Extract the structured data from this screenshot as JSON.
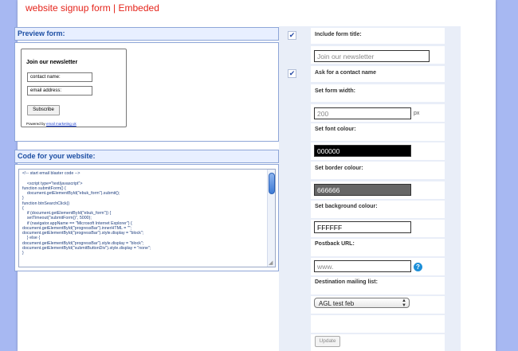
{
  "header": {
    "title": "website signup form | Embeded"
  },
  "preview": {
    "heading": "Preview form:",
    "newsletter_title": "Join our newsletter",
    "contact_placeholder": "contact name:",
    "email_placeholder": "email address:",
    "subscribe_label": "Subscribe",
    "powered_prefix": "Powered by ",
    "powered_link": "email marketing uk"
  },
  "code": {
    "heading": "Code for your website:",
    "text": "<!-- start email blaster code -->\n\n    <script type=\"text/javascript\">\nfunction submitForm() {\n    document.getElementById(\"ebuk_form\").submit();\n}\nfunction btnSearchClick()\n{\n    if (document.getElementById(\"ebuk_form\")) {\n    setTimeout(\"submitForm()\", 5000);\n    if (navigator.appName == \"Microsoft Internet Explorer\") {\ndocument.getElementById(\"progressBar\").innerHTML = \"\";\ndocument.getElementById(\"progressBar\").style.display = \"block\";\n    } else {\ndocument.getElementById(\"progressBar\").style.display = \"block\";\ndocument.getElementById(\"submitButtonDiv\").style.display = \"none\";\n}"
  },
  "settings": {
    "include_title_label": "Include form title:",
    "include_title_checked": true,
    "form_title_value": "Join our newsletter",
    "ask_contact_label": "Ask for a contact name",
    "ask_contact_checked": true,
    "form_width_label": "Set form width:",
    "form_width_value": "200",
    "form_width_unit": "px",
    "font_colour_label": "Set font colour:",
    "font_colour_value": "000000",
    "border_colour_label": "Set border colour:",
    "border_colour_value": "666666",
    "bg_colour_label": "Set background colour:",
    "bg_colour_value": "FFFFFF",
    "postback_label": "Postback URL:",
    "postback_value": "www.",
    "mailing_list_label": "Destination mailing list:",
    "mailing_list_selected": "AGL test feb",
    "update_label": "Update",
    "check_glyph": "✔",
    "help_glyph": "?"
  },
  "colors": {
    "title_red": "#e5241b",
    "panel_blue": "#1d4fa3",
    "font_colour_swatch": "#000000",
    "border_colour_swatch": "#666666",
    "bg_colour_swatch": "#FFFFFF"
  },
  "icons": [
    "check-icon",
    "help-icon",
    "select-arrows-icon",
    "scroll-thumb",
    "resize-grip-icon"
  ]
}
